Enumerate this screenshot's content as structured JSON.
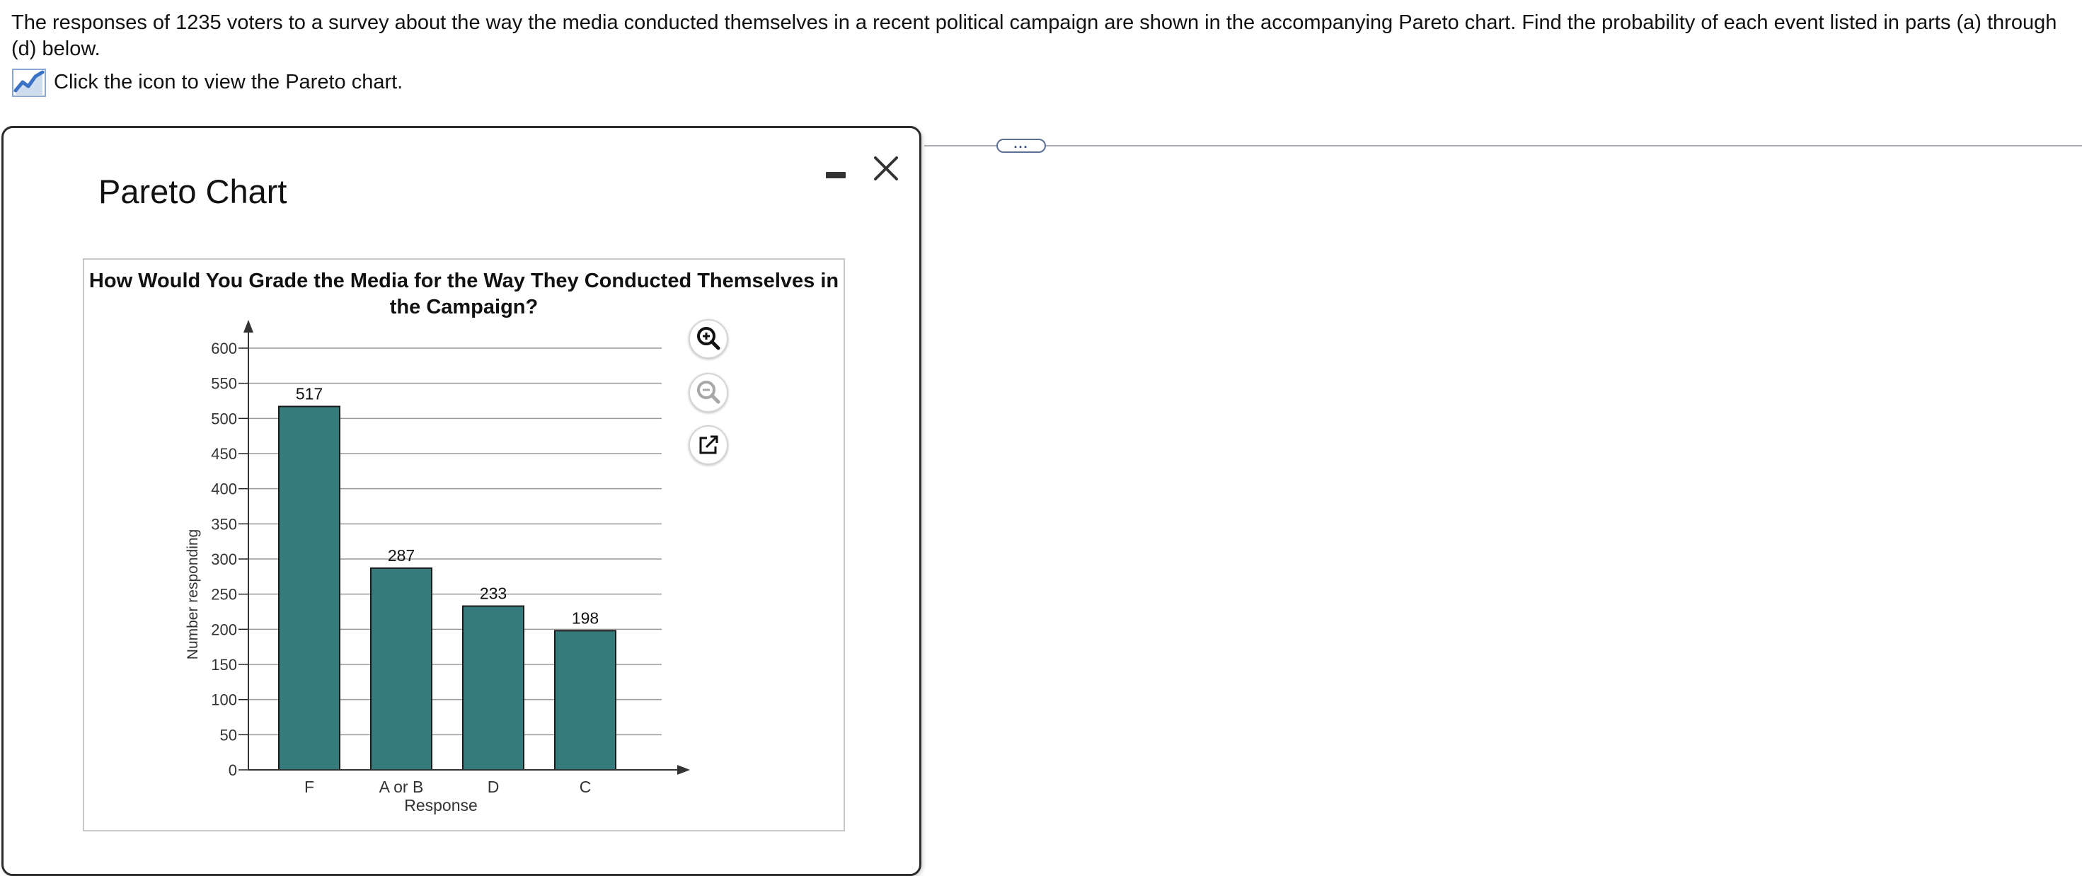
{
  "question": {
    "text": "The responses of 1235 voters to a survey about the way the media conducted themselves in a recent political campaign are shown in the accompanying Pareto chart. Find the probability of each event listed in parts (a) through (d) below.",
    "link_label": "Click the icon to view the Pareto chart."
  },
  "panel": {
    "title": "Pareto Chart",
    "more_label": "..."
  },
  "chart_data": {
    "type": "bar",
    "title": "How Would You Grade the Media for the Way They Conducted Themselves in the Campaign?",
    "categories": [
      "F",
      "A or B",
      "D",
      "C"
    ],
    "values": [
      517,
      287,
      233,
      198
    ],
    "data_labels": [
      "517",
      "287",
      "233",
      "198"
    ],
    "xlabel": "Response",
    "ylabel": "Number responding",
    "ylim": [
      0,
      600
    ],
    "yticks": [
      0,
      50,
      100,
      150,
      200,
      250,
      300,
      350,
      400,
      450,
      500,
      550,
      600
    ],
    "grid": true,
    "bar_color": "#367b7b",
    "bar_edge_color": "#1a1a1a"
  },
  "colors": {
    "accent": "#3b73c4",
    "divider": "#a9aeb5"
  },
  "icons": {
    "link": "line-chart-icon",
    "zoom_in": "zoom-in-icon",
    "zoom_out": "zoom-out-icon",
    "popout": "external-link-icon",
    "minimize": "minimize-icon",
    "close": "close-icon"
  }
}
